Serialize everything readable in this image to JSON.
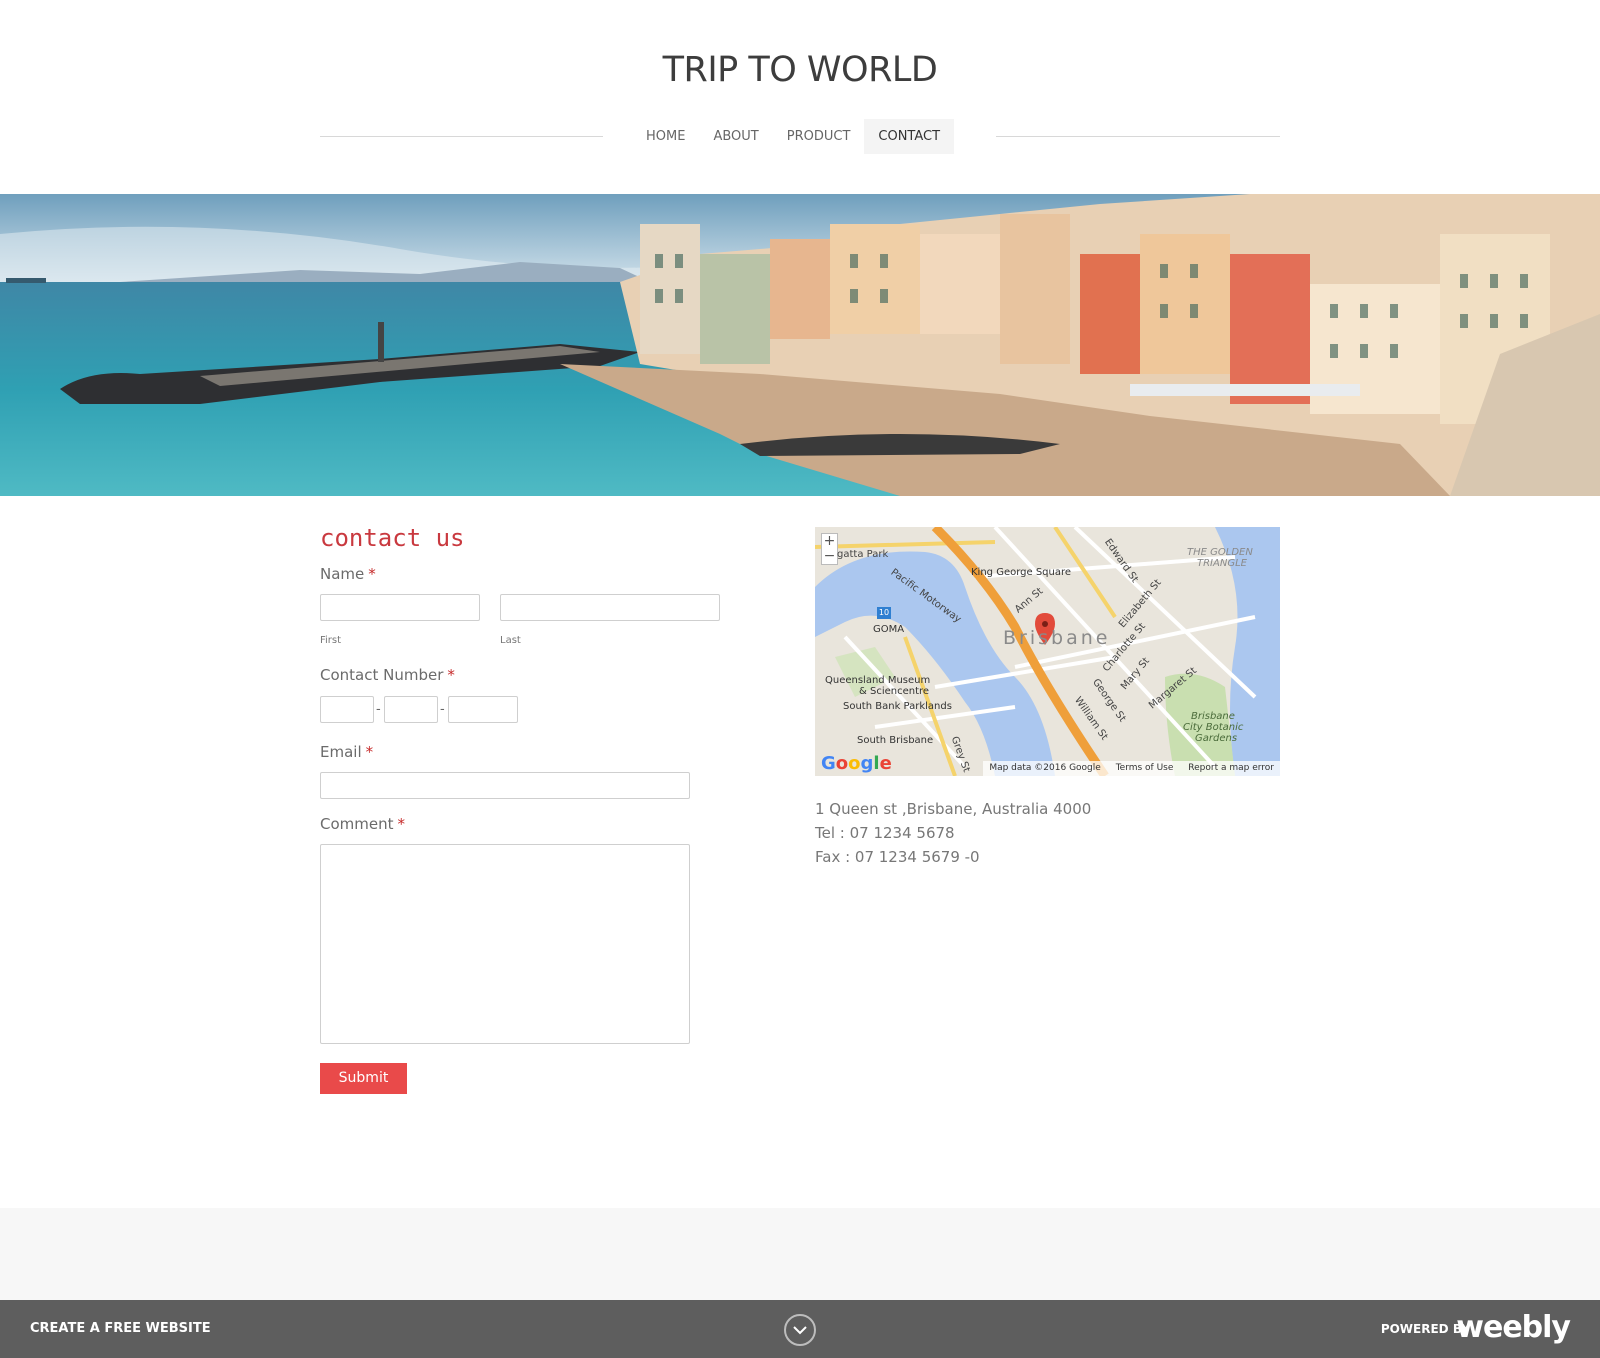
{
  "site": {
    "title": "TRIP TO WORLD"
  },
  "nav": {
    "items": [
      {
        "label": "HOME"
      },
      {
        "label": "ABOUT"
      },
      {
        "label": "PRODUCT"
      },
      {
        "label": "CONTACT",
        "active": true
      }
    ]
  },
  "form": {
    "title": "contact us",
    "required_mark": "*",
    "name_label": "Name",
    "first_label": "First",
    "last_label": "Last",
    "contact_label": "Contact Number",
    "phone_separator": "-",
    "email_label": "Email",
    "comment_label": "Comment",
    "submit_label": "Submit"
  },
  "map": {
    "zoom_in": "+",
    "zoom_out": "−",
    "labels": {
      "park": "gatta Park",
      "motorway": "Pacific Motorway",
      "king_george": "King George Square",
      "ann_st": "Ann St",
      "edward_st": "Edward St",
      "golden_triangle_1": "THE GOLDEN",
      "golden_triangle_2": "TRIANGLE",
      "elizabeth_st": "Elizabeth St",
      "route": "10",
      "goma": "GOMA",
      "brisbane": "Brisbane",
      "charlotte_st": "Charlotte St",
      "museum_1": "Queensland Museum",
      "museum_2": "& Sciencentre",
      "mary_st": "Mary St",
      "margaret_st": "Margaret St",
      "parklands": "South Bank Parklands",
      "george_st": "George St",
      "william_st": "William St",
      "gardens_1": "Brisbane",
      "gardens_2": "City Botanic",
      "gardens_3": "Gardens",
      "south_brisbane": "South Brisbane",
      "grey_st": "Grey St"
    },
    "google": "Google",
    "footer_data": "Map data ©2016 Google",
    "footer_terms": "Terms of Use",
    "footer_report": "Report a map error"
  },
  "address": {
    "line1": "1 Queen st ,Brisbane, Australia 4000",
    "tel": "Tel : 07 1234 5678",
    "fax": "Fax : 07 1234 5679 -0"
  },
  "weebly_bar": {
    "create_label": "CREATE A FREE WEBSITE",
    "powered_label": "POWERED BY",
    "logo_text": "weebly"
  },
  "colors": {
    "accent": "#e94a4a",
    "title_red": "#c9393f",
    "weebly_bar": "#5e5e5e"
  }
}
